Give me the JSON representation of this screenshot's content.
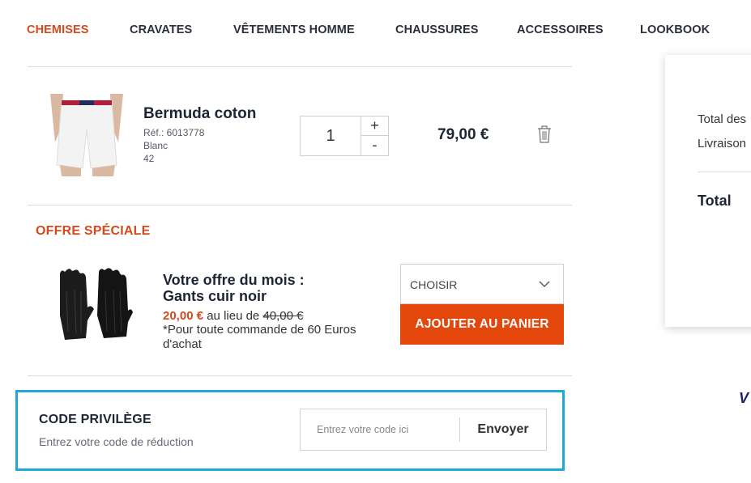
{
  "nav": {
    "items": [
      {
        "label": "CHEMISES",
        "active": true
      },
      {
        "label": "CRAVATES",
        "active": false
      },
      {
        "label": "VÊTEMENTS HOMME",
        "active": false
      },
      {
        "label": "CHAUSSURES",
        "active": false
      },
      {
        "label": "ACCESSOIRES",
        "active": false
      },
      {
        "label": "LOOKBOOK",
        "active": false
      }
    ]
  },
  "cart_item": {
    "name": "Bermuda coton",
    "ref": "Réf.: 6013778",
    "color": "Blanc",
    "size": "42",
    "quantity": "1",
    "qty_plus": "+",
    "qty_minus": "-",
    "price": "79,00 €",
    "image_icon": "white-bermuda-shorts-photo",
    "delete_icon": "trash-icon"
  },
  "special_offer": {
    "title": "OFFRE SPÉCIALE",
    "name_line1": "Votre offre du mois :",
    "name_line2": "Gants cuir noir",
    "price": "20,00 €",
    "instead_of": "au lieu de",
    "old_price": "40,00 €",
    "note": "*Pour toute commande de 60 Euros d'achat",
    "select_label": "CHOISIR",
    "add_button": "AJOUTER AU PANIER",
    "image_icon": "black-leather-gloves-photo"
  },
  "promo": {
    "title": "CODE PRIVILÈGE",
    "subtitle": "Entrez votre code de réduction",
    "placeholder": "Entrez votre code ici",
    "value": "",
    "send_button": "Envoyer"
  },
  "summary": {
    "products_label": "Total des",
    "shipping_label": "Livraison",
    "total_label": "Total"
  },
  "payment": {
    "visa_partial": "V"
  },
  "colors": {
    "accent": "#d7491b",
    "button": "#e3470c",
    "promo_border": "#21a6d9",
    "text_dark": "#1d2535"
  }
}
